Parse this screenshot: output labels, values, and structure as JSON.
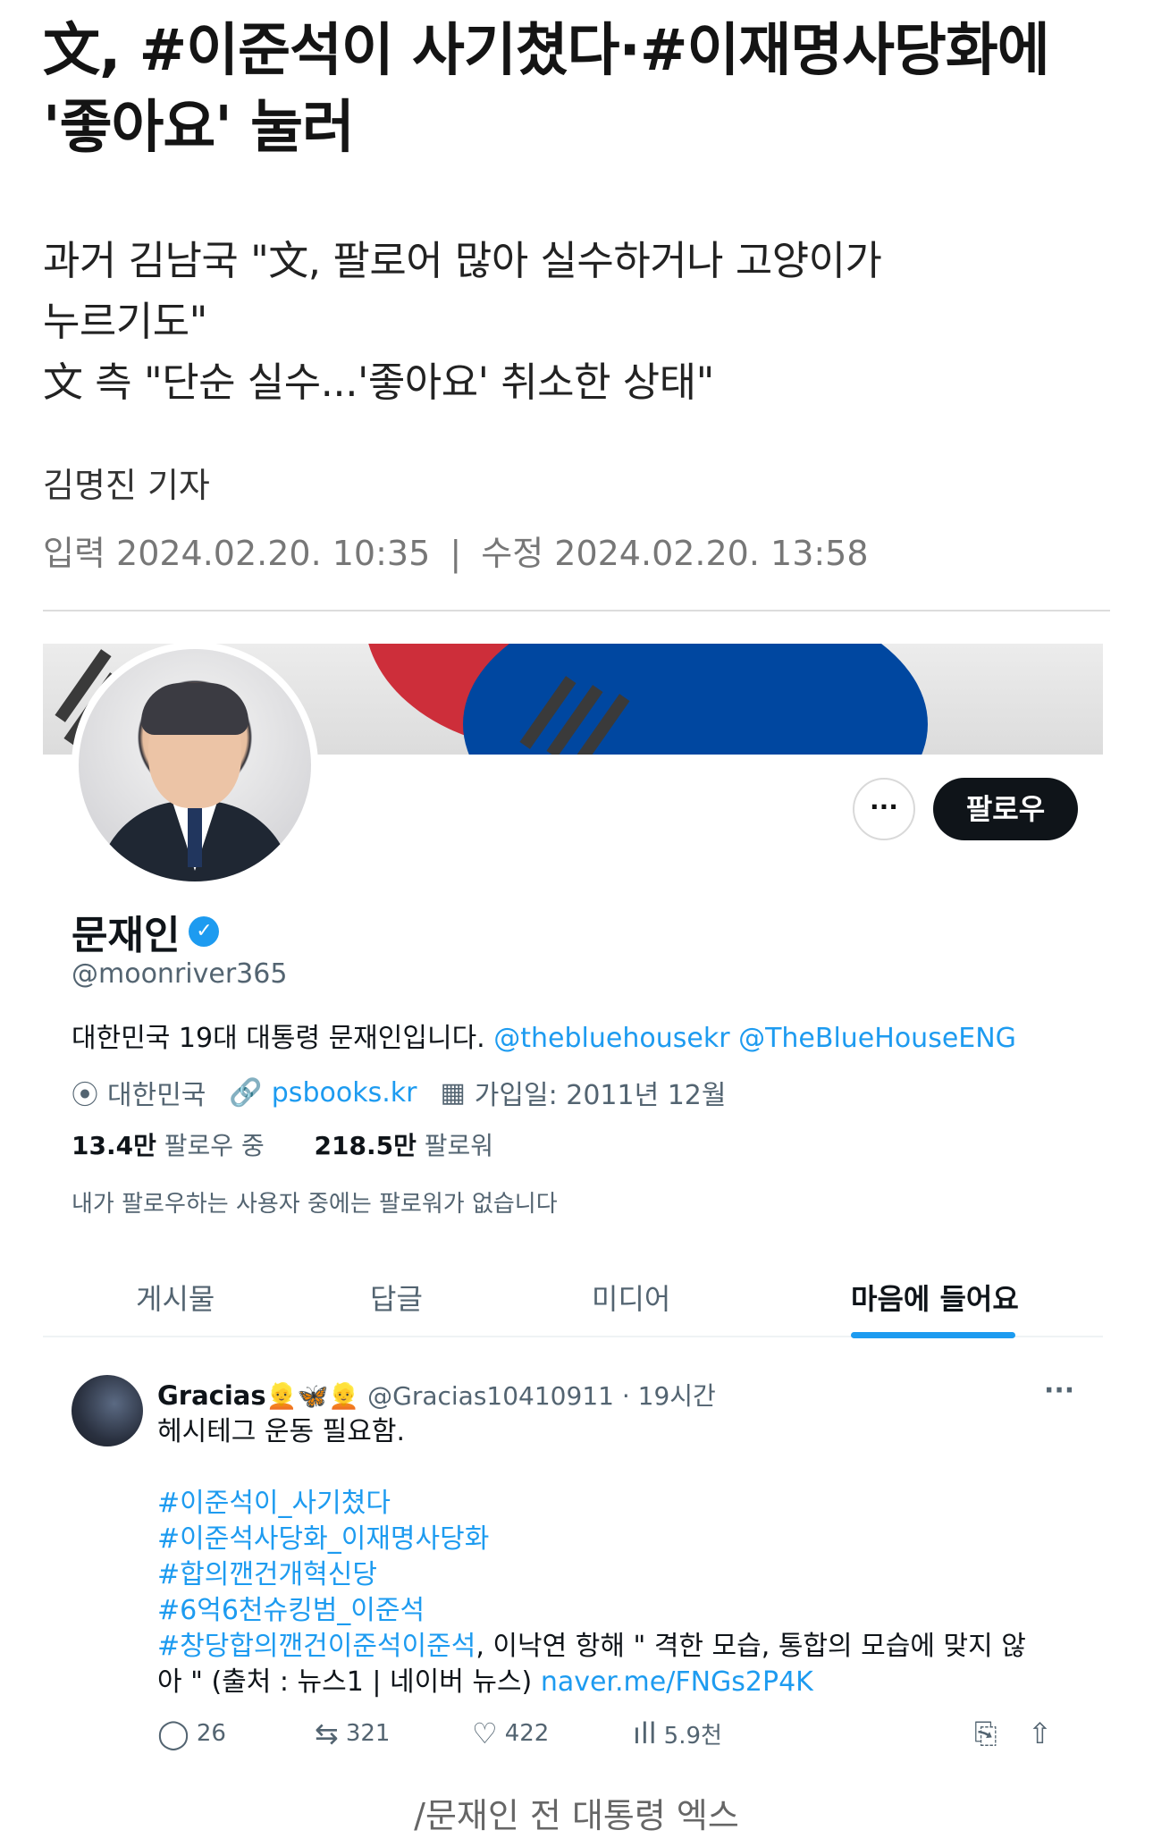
{
  "article": {
    "title_line1": "文, #이준석이 사기쳤다·#이재명사당화에",
    "title_line2": "'좋아요' 눌러",
    "subtitle_line1": "과거 김남국 \"文, 팔로어 많아 실수하거나 고양이가",
    "subtitle_line2": "누르기도\"",
    "subtitle_line3": "文 측 \"단순 실수...'좋아요' 취소한 상태\"",
    "author": "김명진 기자",
    "input_label": "입력",
    "input_date": "2024.02.20. 10:35",
    "divider": "|",
    "edit_label": "수정",
    "edit_date": "2024.02.20. 13:58",
    "caption": "/문재인 전 대통령 엑스"
  },
  "profile": {
    "more_label": "···",
    "follow_label": "팔로우",
    "name": "문재인",
    "verified_mark": "✓",
    "handle": "@moonriver365",
    "bio_text": "대한민국 19대 대통령 문재인입니다.",
    "bio_link1": "@thebluehousekr",
    "bio_link2": "@TheBlueHouseENG",
    "location_icon": "⦿",
    "location": "대한민국",
    "link_icon": "🔗",
    "website": "psbooks.kr",
    "calendar_icon": "▦",
    "joined": "가입일: 2011년 12월",
    "following_count": "13.4만",
    "following_label": "팔로우 중",
    "followers_count": "218.5만",
    "followers_label": "팔로워",
    "followed_by": "내가 팔로우하는 사용자 중에는 팔로워가 없습니다"
  },
  "tabs": {
    "posts": "게시물",
    "replies": "답글",
    "media": "미디어",
    "likes": "마음에 들어요"
  },
  "tweet": {
    "name": "Gracias",
    "emojis": "👱🦋👱",
    "handle": "@Gracias10410911",
    "dot": "·",
    "time": "19시간",
    "more": "···",
    "line1": "헤시테그 운동 필요함.",
    "hashtag1": "#이준석이_사기쳤다",
    "hashtag2": "#이준석사당화_이재명사당화",
    "hashtag3": "#합의깬건개혁신당",
    "hashtag4": "#6억6천슈킹범_이준석",
    "hashtag5": "#창당합의깬건이준석이준석",
    "line_rest": ", 이낙연 항해 \" 격한 모습, 통합의 모습에 맞지 않",
    "line_last": "아 \" (출처 : 뉴스1 | 네이버 뉴스)",
    "link": "naver.me/FNGs2P4K",
    "reply_icon": "◯",
    "reply_count": "26",
    "retweet_icon": "⇆",
    "retweet_count": "321",
    "like_icon": "♡",
    "like_count": "422",
    "views_icon": "ıll",
    "views_count": "5.9천",
    "bookmark_icon": "⎘",
    "share_icon": "⇧"
  }
}
